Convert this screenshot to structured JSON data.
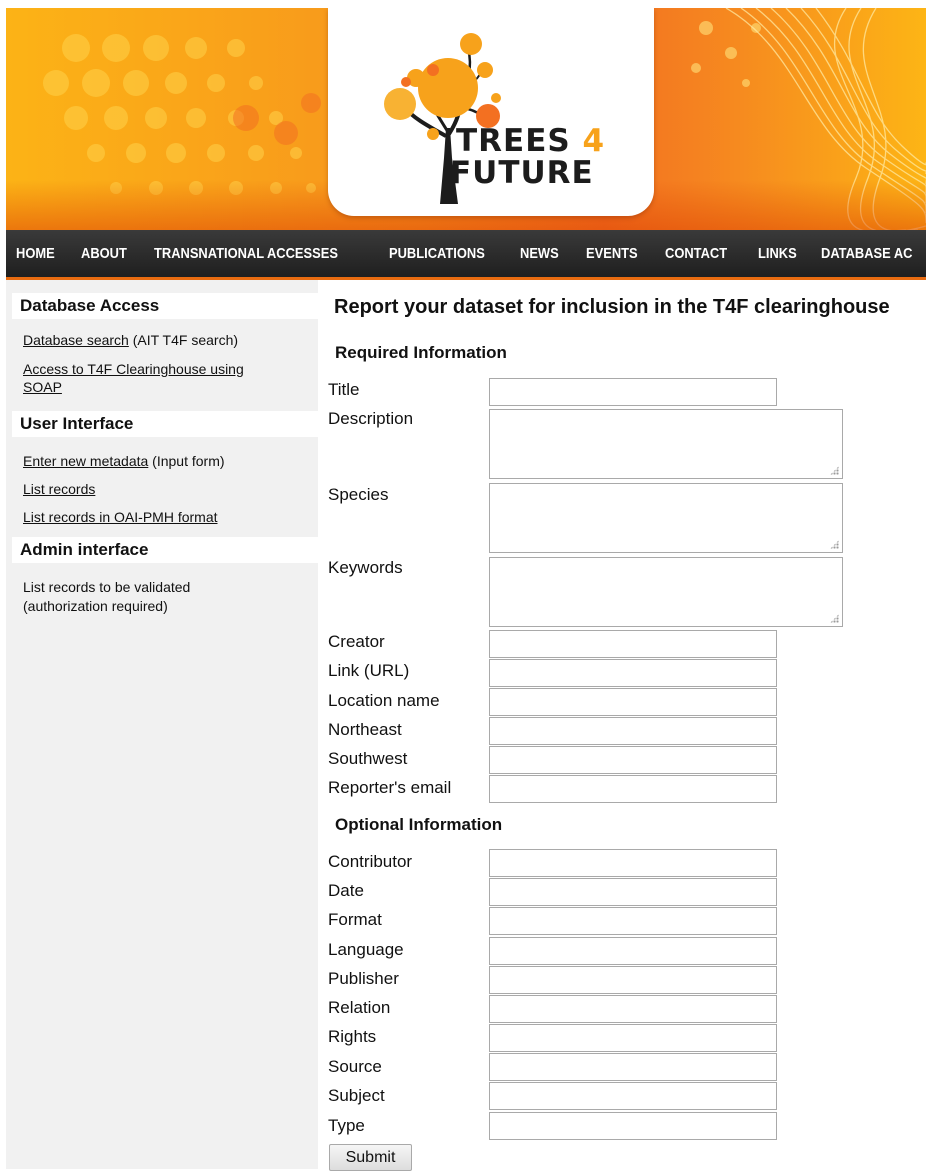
{
  "colors": {
    "header_orange": "#f7941d",
    "header_yellow": "#fcb316",
    "nav_background": "#2a2a2a",
    "nav_accent": "#e86b10",
    "sidebar_background": "#f1f1f1"
  },
  "logo": {
    "line1": "TREES",
    "accent": "4",
    "line2": "FUTURE"
  },
  "nav": {
    "items": [
      "HOME",
      "ABOUT",
      "TRANSNATIONAL ACCESSES",
      "PUBLICATIONS",
      "NEWS",
      "EVENTS",
      "CONTACT",
      "LINKS",
      "DATABASE AC"
    ]
  },
  "sidebar": {
    "database_access": {
      "heading": "Database Access",
      "search_link": "Database search",
      "search_note": " (AIT T4F search)",
      "soap_link_line1": "Access to T4F Clearinghouse using",
      "soap_link_line2": "SOAP"
    },
    "user_interface": {
      "heading": "User Interface",
      "enter_link": "Enter new metadata",
      "enter_note": " (Input form)",
      "list_records": "List records",
      "list_oai": "List records in OAI-PMH format"
    },
    "admin_interface": {
      "heading": "Admin interface",
      "line1": "List records to be validated",
      "line2": "(authorization required)"
    }
  },
  "form": {
    "title": "Report your dataset for inclusion in the T4F clearinghouse",
    "required_heading": "Required Information",
    "required": {
      "title": "Title",
      "description": "Description",
      "species": "Species",
      "keywords": "Keywords",
      "creator": "Creator",
      "link": "Link (URL)",
      "location_name": "Location name",
      "northeast": "Northeast",
      "southwest": "Southwest",
      "reporter_email": "Reporter's email"
    },
    "optional_heading": "Optional Information",
    "optional": {
      "contributor": "Contributor",
      "date": "Date",
      "format": "Format",
      "language": "Language",
      "publisher": "Publisher",
      "relation": "Relation",
      "rights": "Rights",
      "source": "Source",
      "subject": "Subject",
      "type": "Type"
    },
    "submit_label": "Submit"
  }
}
